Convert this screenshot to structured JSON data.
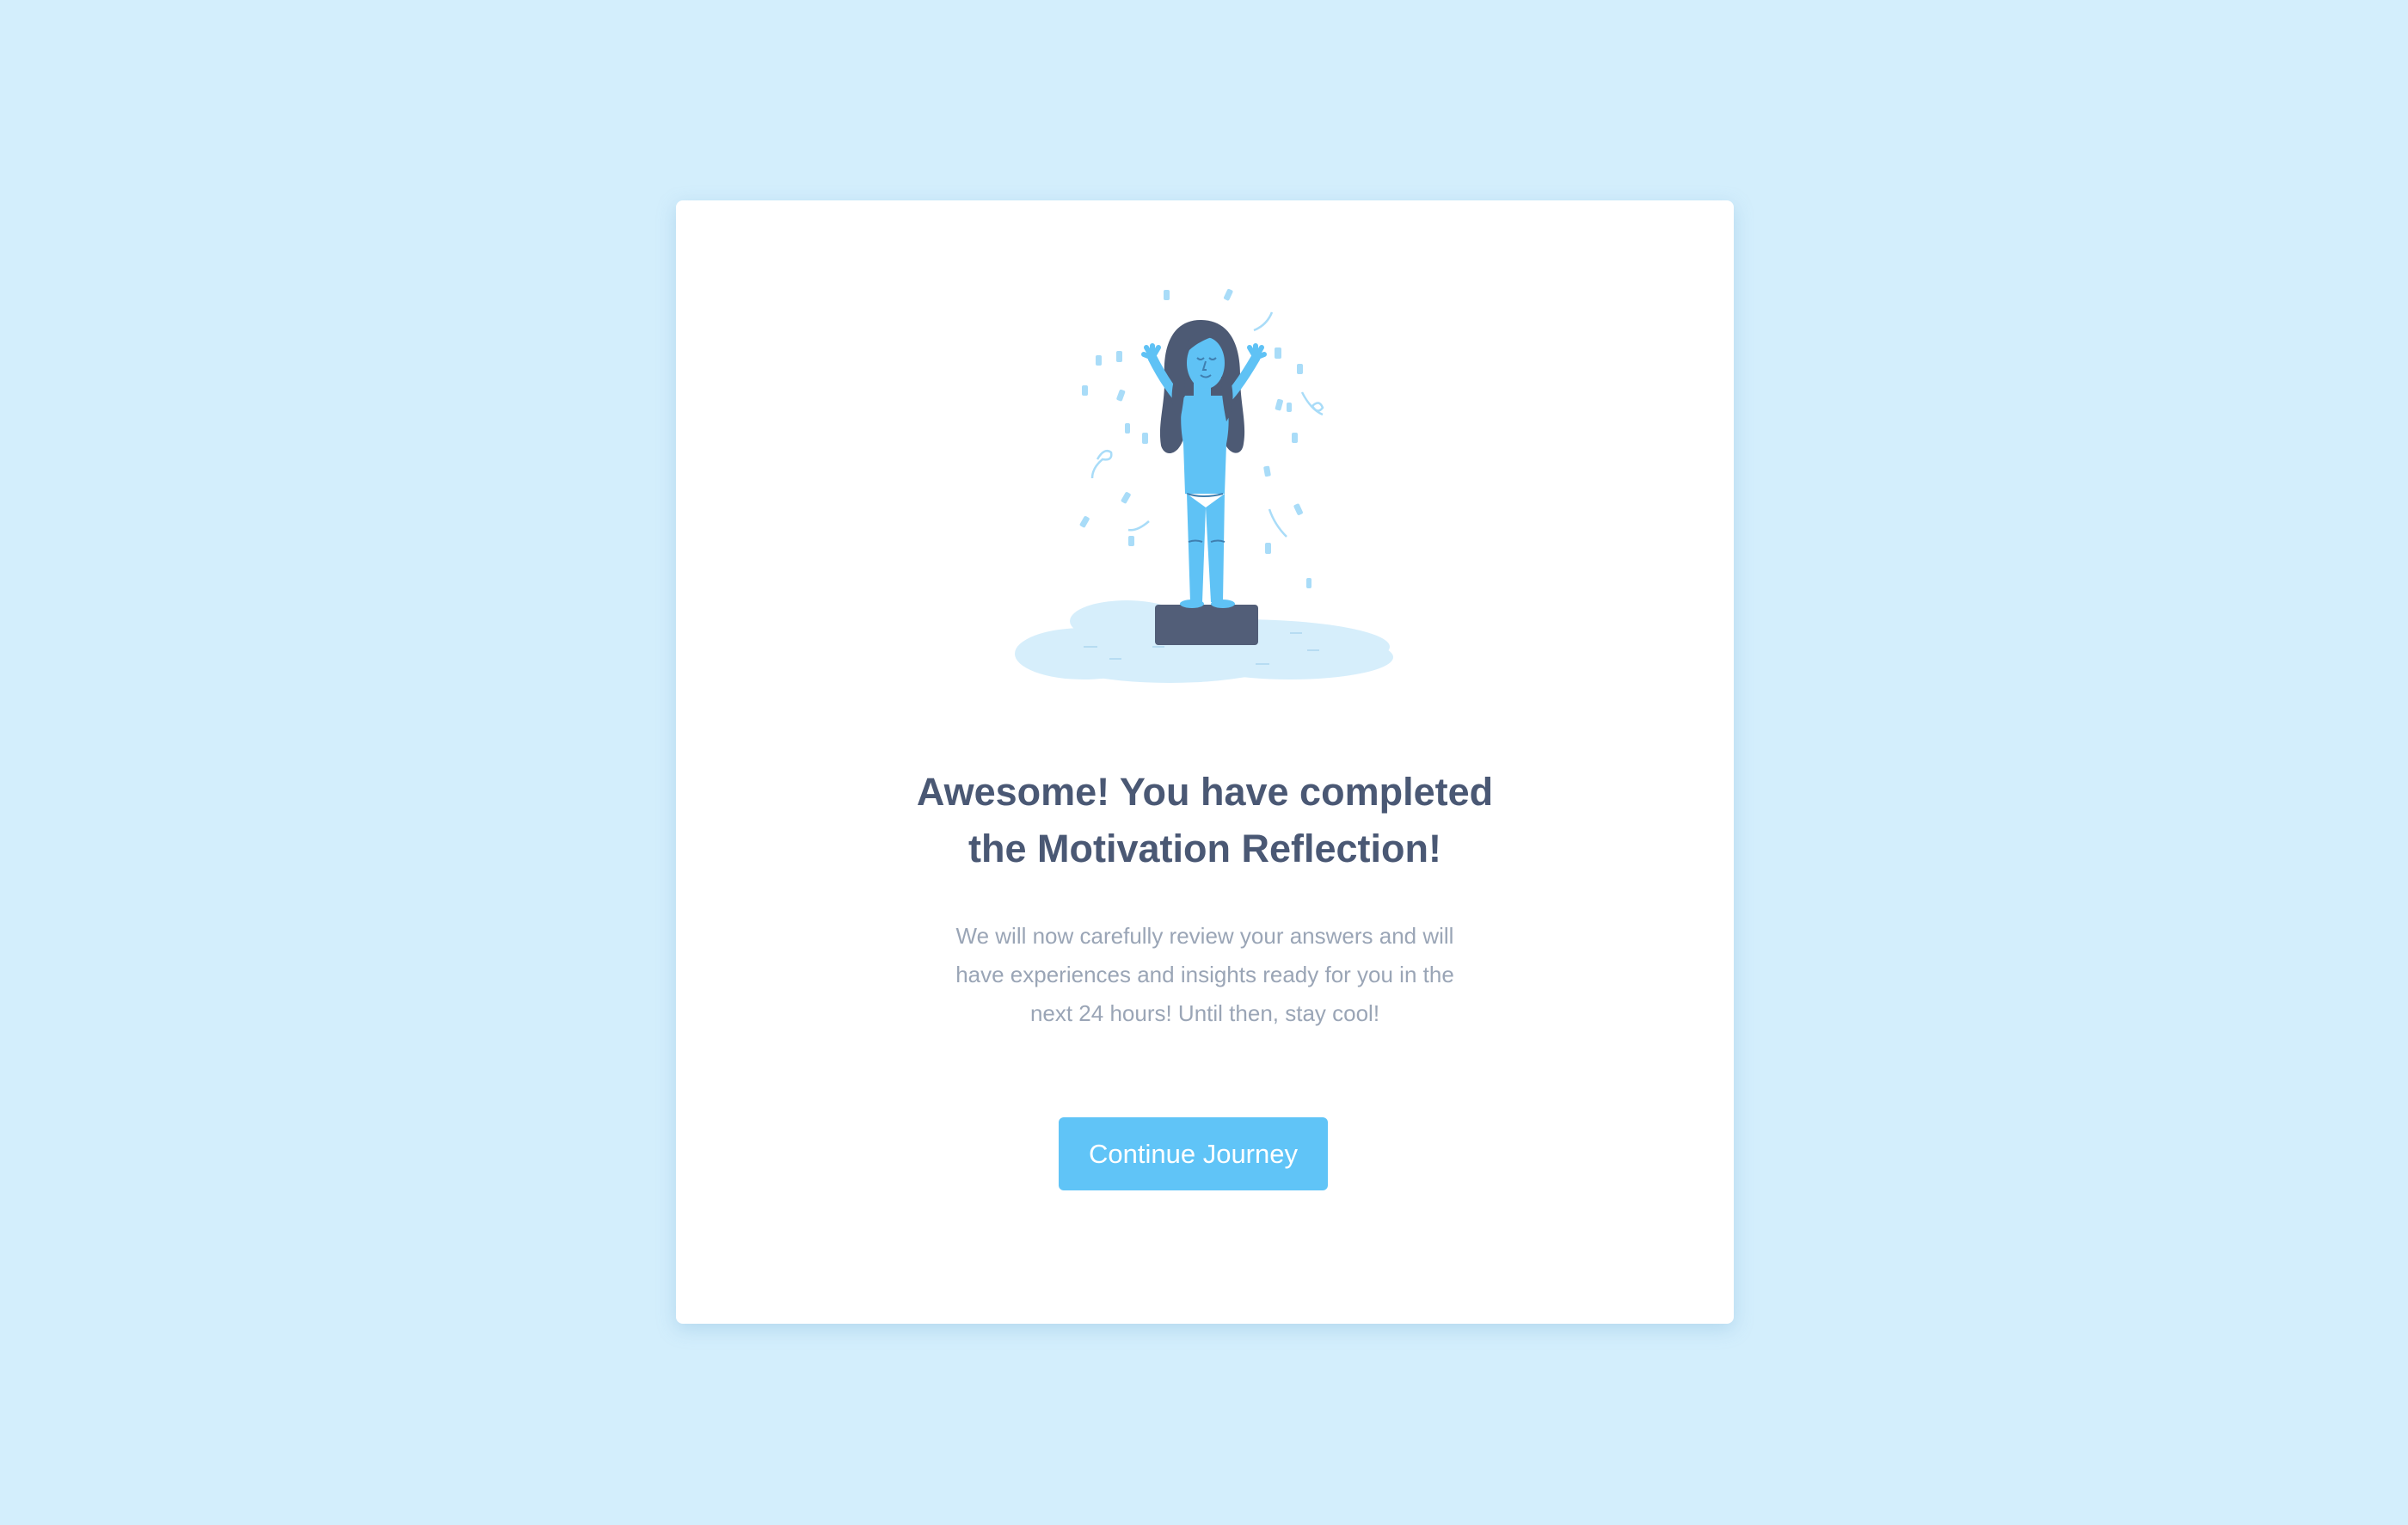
{
  "colors": {
    "background": "#d3eefc",
    "card": "#ffffff",
    "title": "#4a5874",
    "body_text": "#9aa5b6",
    "accent": "#60c4f7",
    "figure": "#5fc2f5",
    "hair": "#4d5a74",
    "pedestal": "#525e78",
    "cloud": "#d6eefb"
  },
  "illustration": {
    "name": "celebrating-woman-on-pedestal-illustration"
  },
  "completion": {
    "title_line1": "Awesome! You have completed",
    "title_line2": "the Motivation Reflection!",
    "description_line1": "We will now carefully review your answers and will",
    "description_line2": "have experiences and insights ready for you in the",
    "description_line3": "next 24 hours! Until then, stay cool!",
    "button_label": "Continue Journey"
  }
}
